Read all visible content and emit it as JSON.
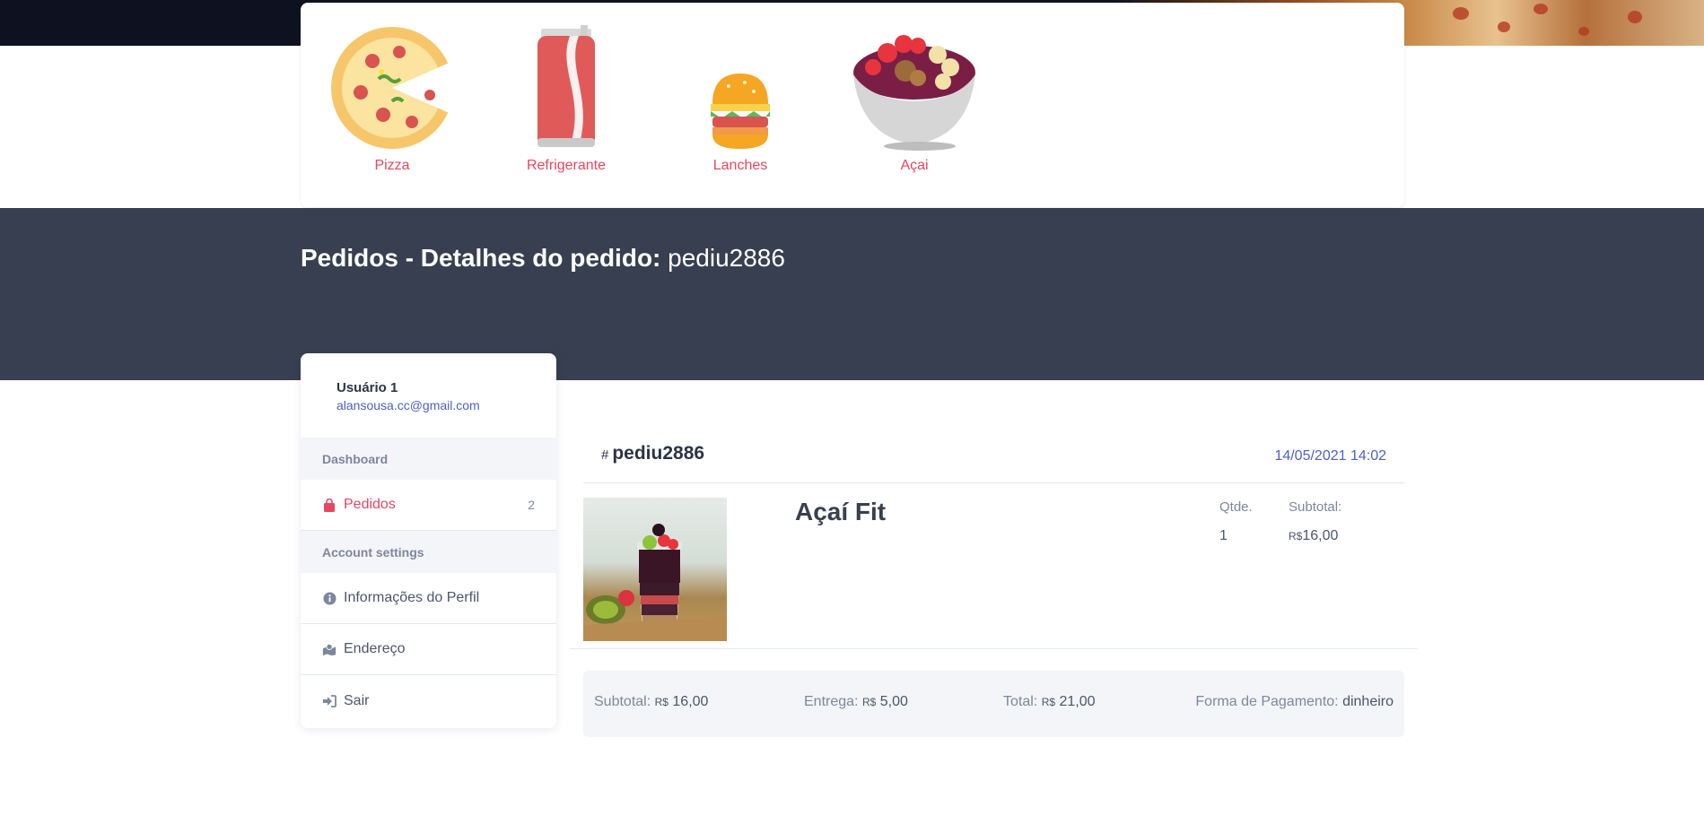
{
  "categories": [
    {
      "label": "Pizza",
      "icon": "pizza-icon"
    },
    {
      "label": "Refrigerante",
      "icon": "soda-can-icon"
    },
    {
      "label": "Lanches",
      "icon": "burger-icon"
    },
    {
      "label": "Açai",
      "icon": "acai-bowl-icon"
    }
  ],
  "header": {
    "title": "Pedidos - Detalhes do pedido:",
    "order_code": "pediu2886"
  },
  "sidebar": {
    "user_name": "Usuário 1",
    "user_email": "alansousa.cc@gmail.com",
    "dashboard_heading": "Dashboard",
    "orders_label": "Pedidos",
    "orders_count": "2",
    "account_heading": "Account settings",
    "profile_label": "Informações do Perfil",
    "address_label": "Endereço",
    "logout_label": "Sair"
  },
  "order": {
    "hash": "#",
    "code": "pediu2886",
    "date": "14/05/2021 14:02",
    "item": {
      "name": "Açaí Fit",
      "qty_label": "Qtde.",
      "qty": "1",
      "subtotal_label": "Subtotal:",
      "currency": "R$",
      "subtotal": "16,00"
    },
    "summary": {
      "subtotal_label": "Subtotal:",
      "subtotal": "16,00",
      "delivery_label": "Entrega:",
      "delivery": "5,00",
      "total_label": "Total:",
      "total": "21,00",
      "payment_label": "Forma de Pagamento:",
      "payment": "dinheiro"
    }
  },
  "colors": {
    "accent": "#e94560",
    "hero_bg": "#373f50",
    "link": "#4e5fc7"
  }
}
